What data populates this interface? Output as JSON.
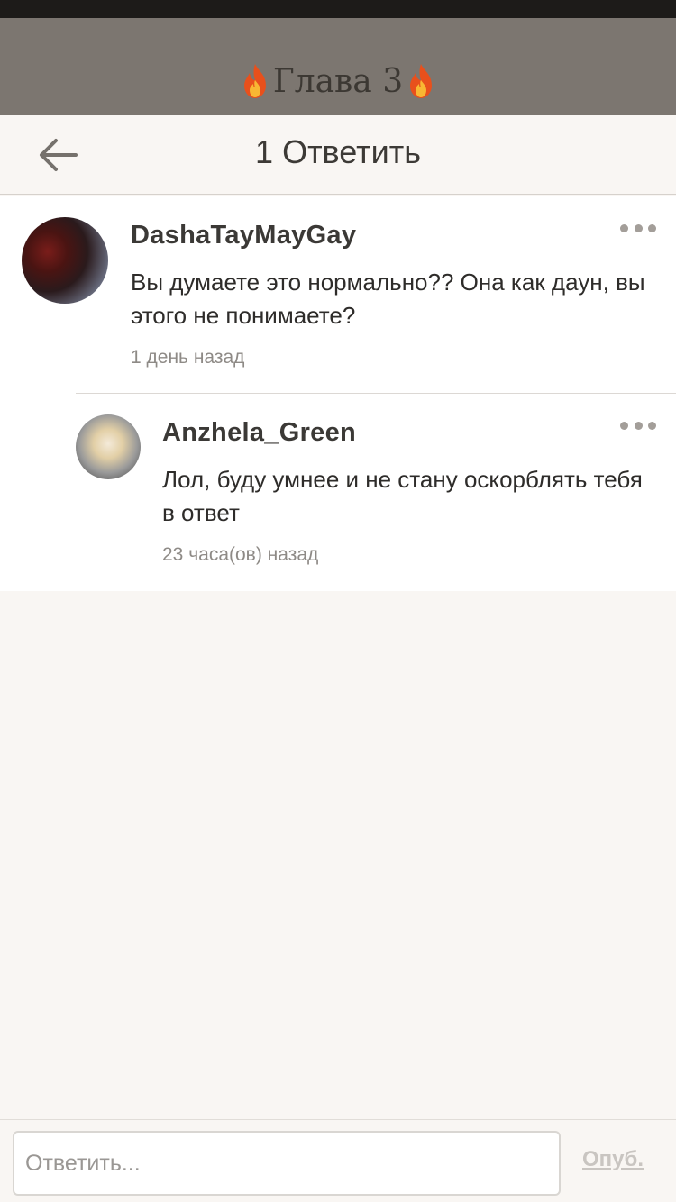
{
  "background": {
    "chapter_title": "Глава 3"
  },
  "header": {
    "title": "1 Ответить"
  },
  "comments": [
    {
      "username": "DashaTayMayGay",
      "text": "Вы думаете это нормально?? Она как даун, вы этого не понимаете?",
      "time": "1 день назад"
    }
  ],
  "replies": [
    {
      "username": "Anzhela_Green",
      "text": "Лол, буду умнее и не стану оскорблять тебя в ответ",
      "time": "23 часа(ов) назад"
    }
  ],
  "input": {
    "placeholder": "Ответить...",
    "value": ""
  },
  "publish_label": "Опуб.",
  "colors": {
    "accent_bg": "#f9f6f3",
    "overlay": "#7c7670",
    "publish_disabled": "#c9c5c1"
  },
  "icons": {
    "back": "arrow-left-icon",
    "more": "more-dots-icon",
    "flame": "fire-icon"
  }
}
